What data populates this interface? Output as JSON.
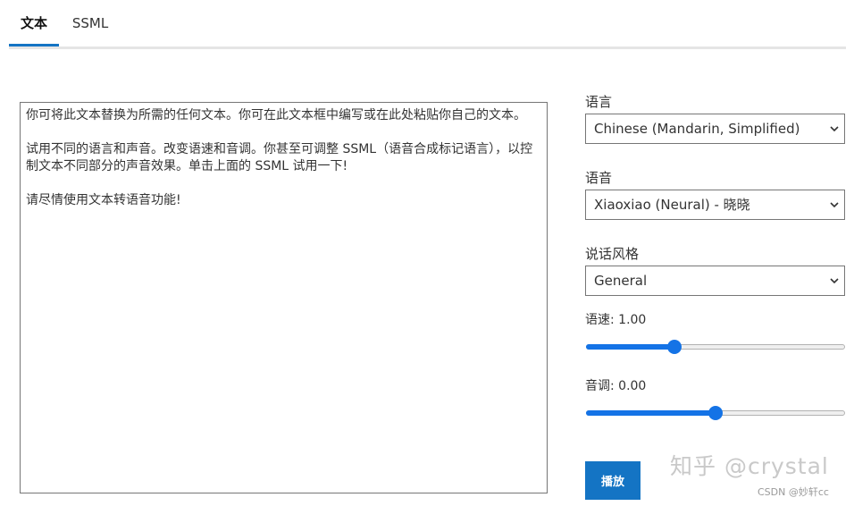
{
  "tabs": [
    {
      "label": "文本",
      "active": true
    },
    {
      "label": "SSML",
      "active": false
    }
  ],
  "editor": {
    "paragraphs": [
      "你可将此文本替换为所需的任何文本。你可在此文本框中编写或在此处粘贴你自己的文本。",
      "试用不同的语言和声音。改变语速和音调。你甚至可调整 SSML（语音合成标记语言），以控制文本不同部分的声音效果。单击上面的 SSML 试用一下!",
      "请尽情使用文本转语音功能!"
    ]
  },
  "language": {
    "label": "语言",
    "selected": "Chinese (Mandarin, Simplified)"
  },
  "voice": {
    "label": "语音",
    "selected": "Xiaoxiao (Neural) - 晓晓"
  },
  "style": {
    "label": "说话风格",
    "selected": "General"
  },
  "rate": {
    "label": "语速: 1.00",
    "value_fraction": 0.34
  },
  "pitch": {
    "label": "音调: 0.00",
    "value_fraction": 0.5
  },
  "play_button": {
    "label": "播放"
  },
  "watermark": {
    "text": "知乎 @crystal",
    "credit": "CSDN @妙轩cc"
  },
  "colors": {
    "accent": "#1474c4",
    "slider": "#1473e6"
  }
}
